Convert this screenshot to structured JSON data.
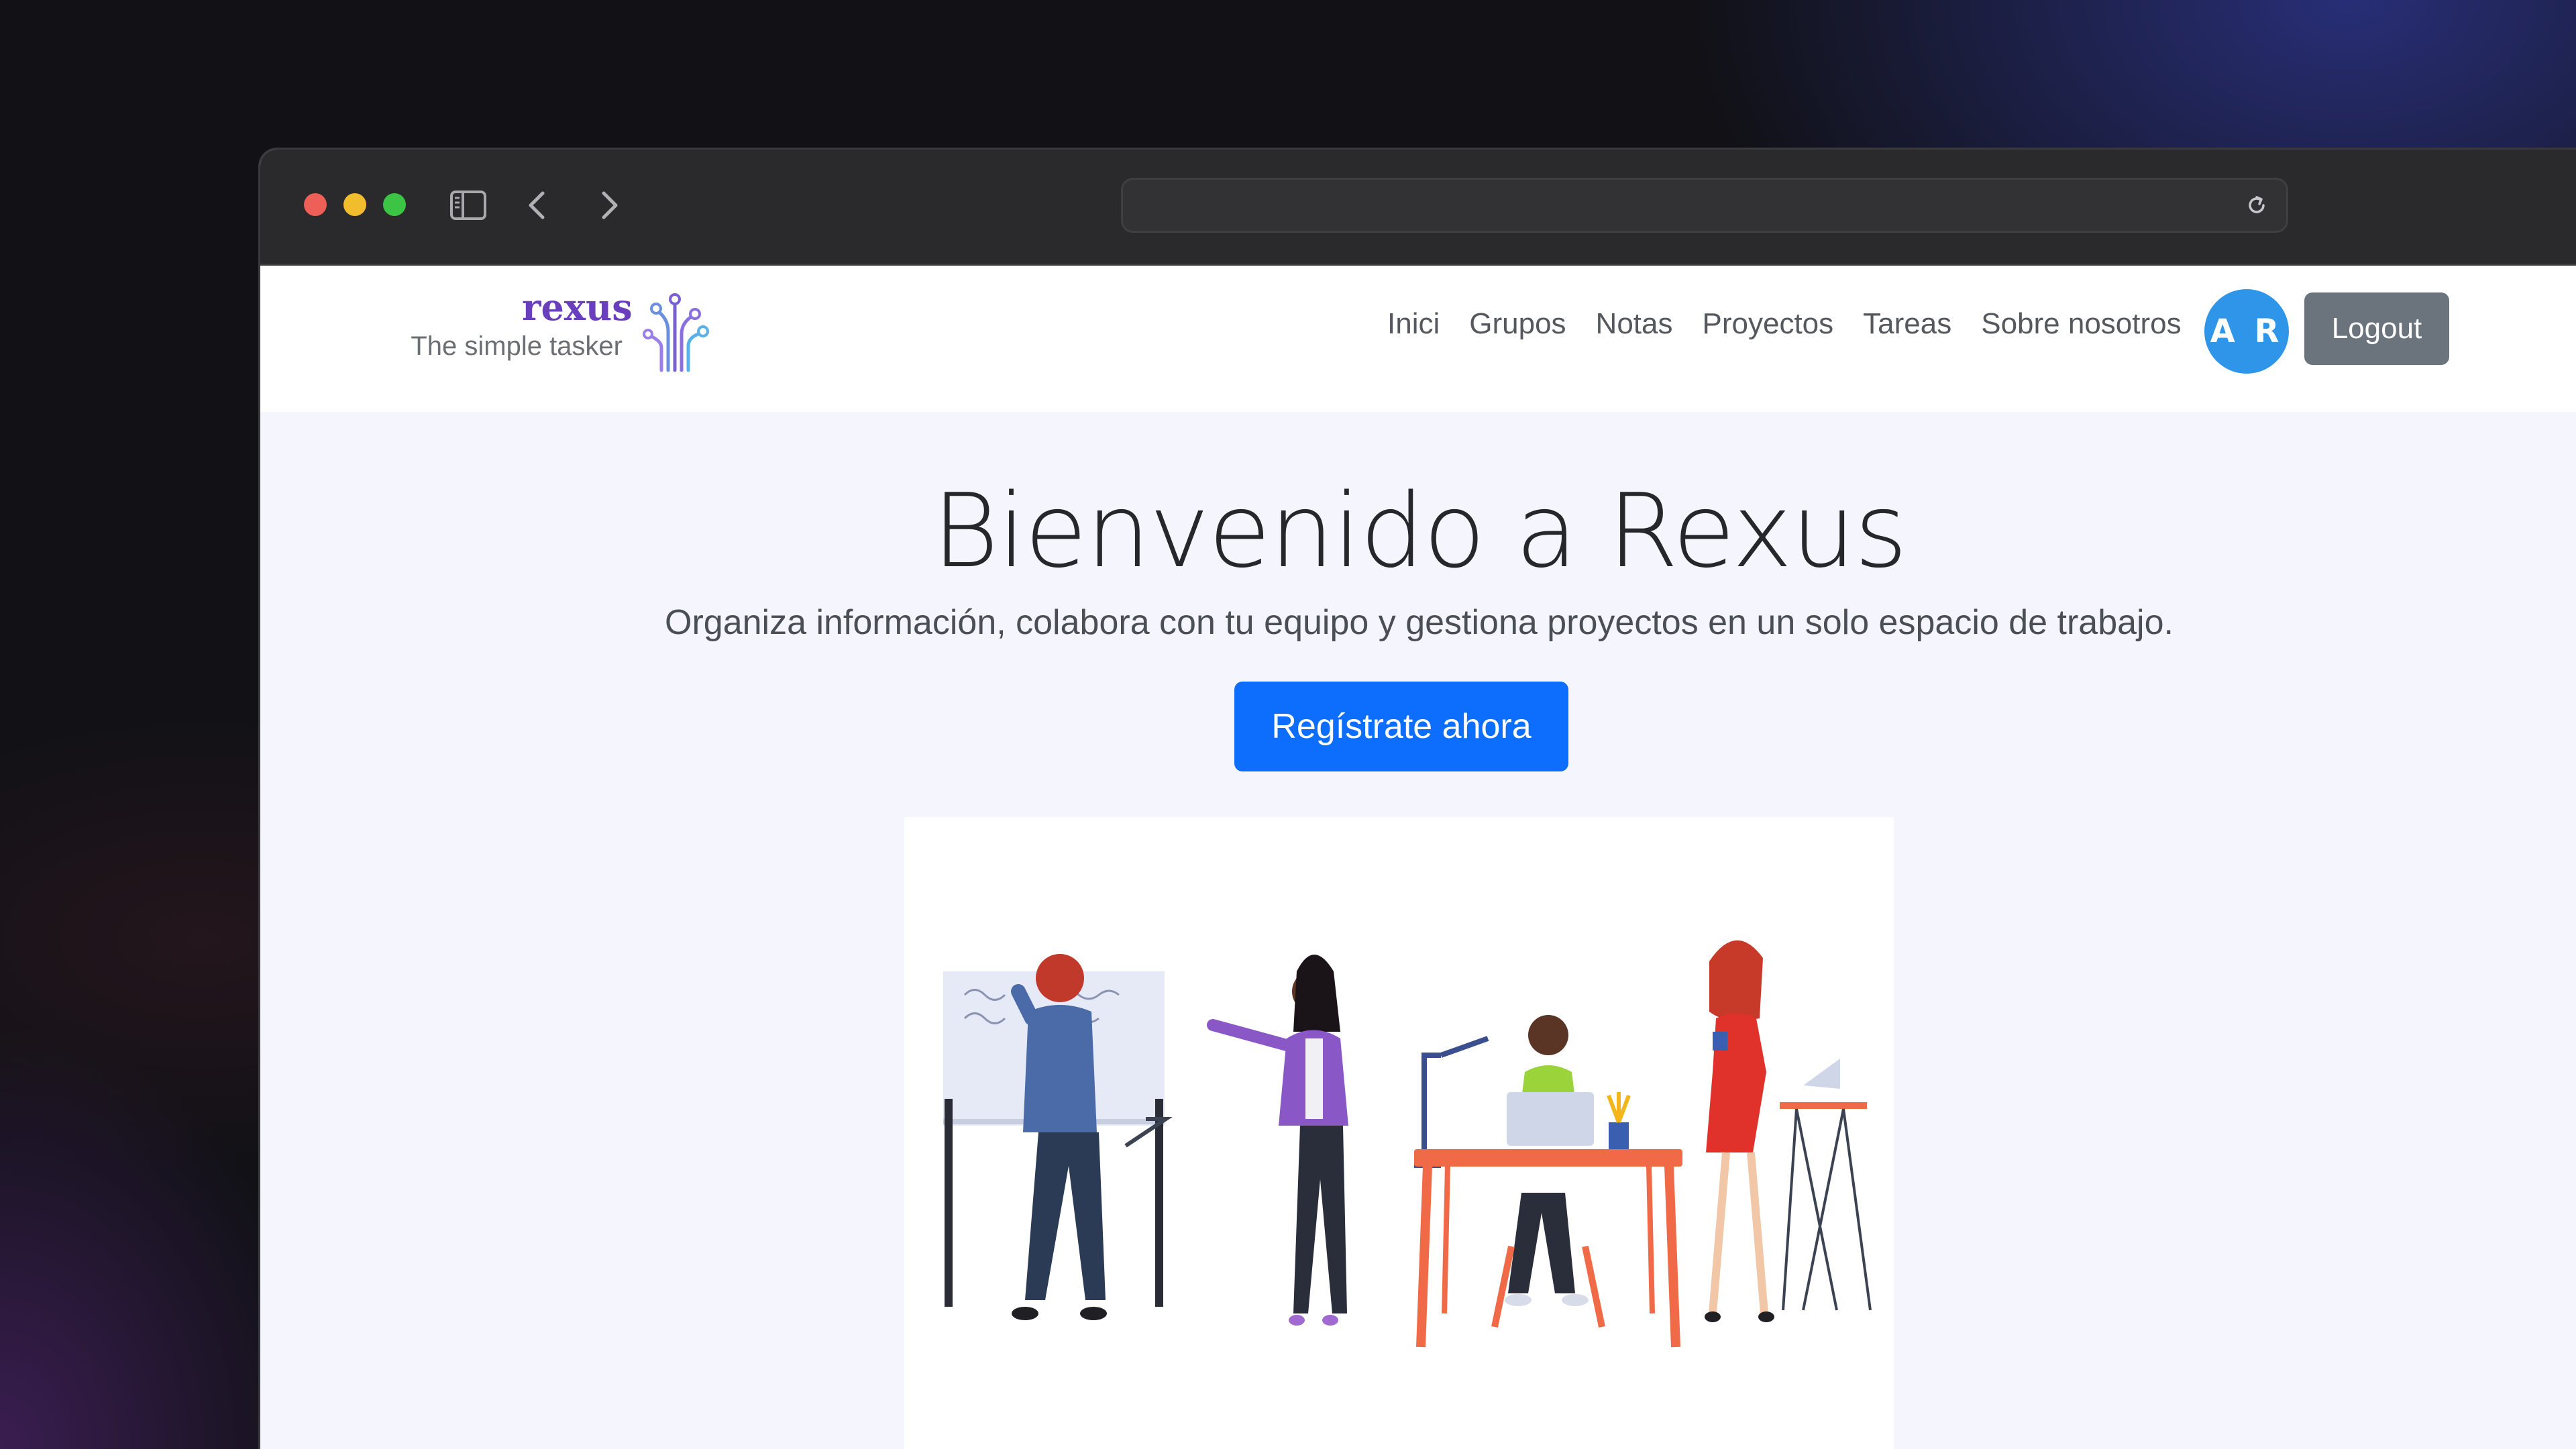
{
  "browser": {
    "url": "",
    "icons": [
      "sidebar-toggle-icon",
      "back-arrow-icon",
      "forward-arrow-icon",
      "reload-icon"
    ]
  },
  "navbar": {
    "brand_name": "rexus",
    "brand_tagline": "The simple tasker",
    "links": [
      "Inici",
      "Grupos",
      "Notas",
      "Proyectos",
      "Tareas",
      "Sobre nosotros"
    ],
    "avatar_initials": "A R",
    "logout_label": "Logout"
  },
  "hero": {
    "title": "Bienvenido a Rexus",
    "subtitle": "Organiza información, colabora con tu equipo y gestiona proyectos en un solo espacio de trabajo.",
    "cta_label": "Regístrate ahora"
  },
  "colors": {
    "brand_purple": "#6a3fbd",
    "primary_button": "#0d6efd",
    "avatar": "#2f95e8",
    "logout_button": "#6b747d",
    "page_background": "#f4f5fd"
  }
}
